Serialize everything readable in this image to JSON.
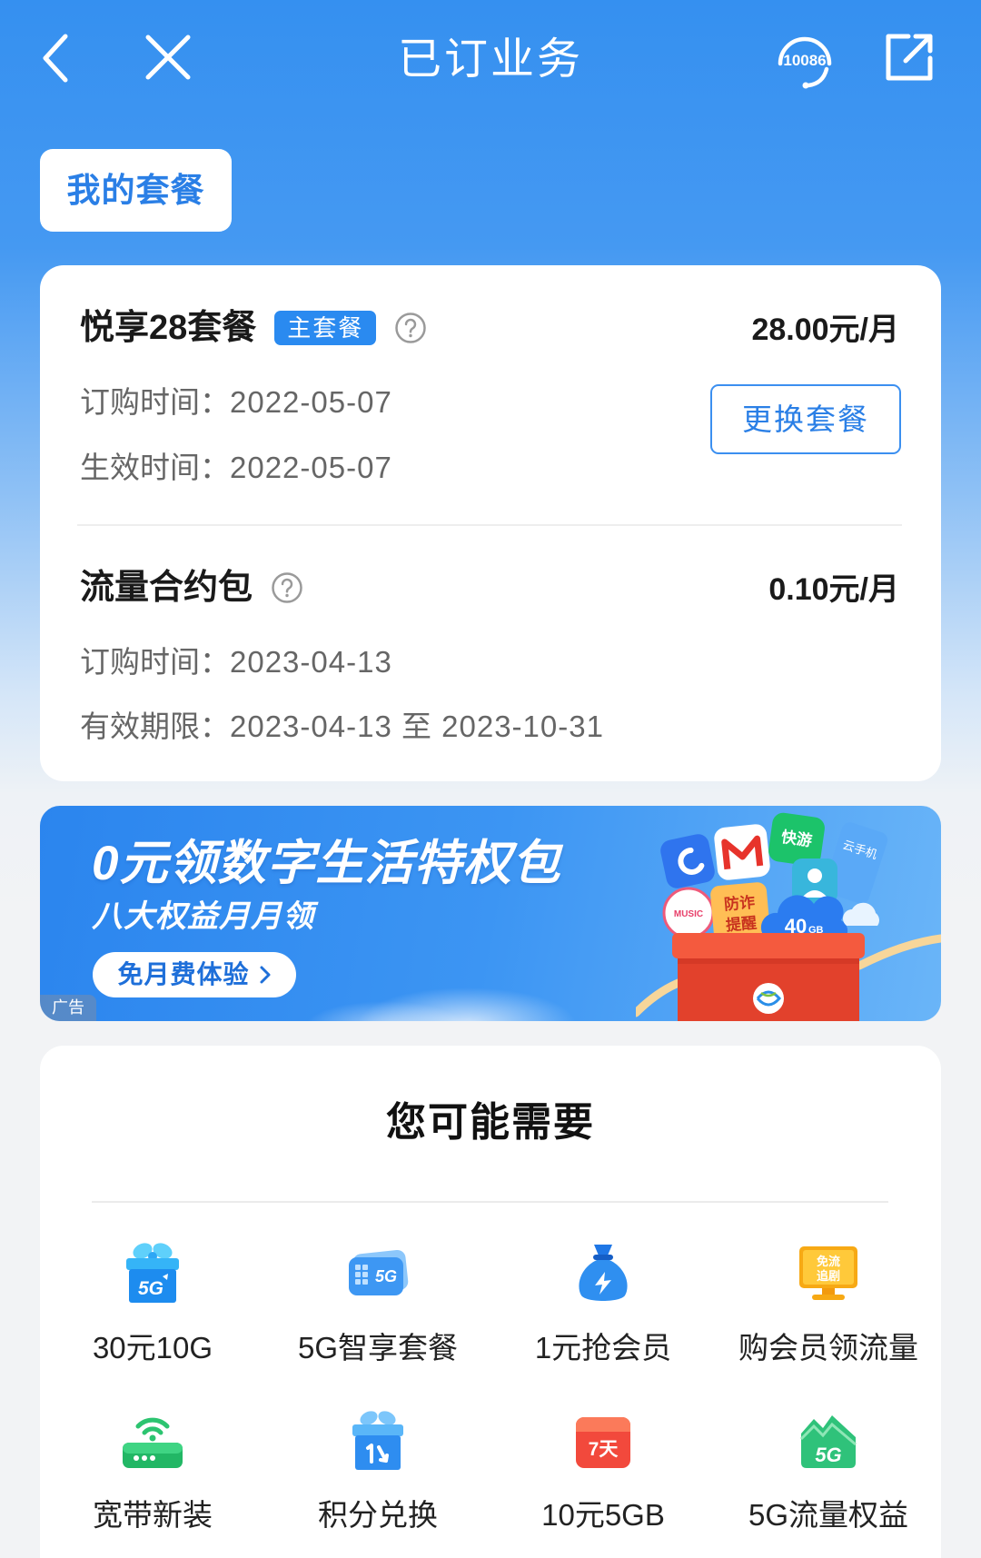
{
  "header": {
    "title": "已订业务",
    "hotline": "10086",
    "back_icon": "chevron-left-icon",
    "close_icon": "close-icon",
    "service_icon": "headset-icon",
    "share_icon": "share-icon"
  },
  "tab": {
    "label": "我的套餐"
  },
  "packages": [
    {
      "name": "悦享28套餐",
      "badge": "主套餐",
      "price": "28.00元/月",
      "rows": [
        {
          "label": "订购时间：",
          "value": "2022-05-07"
        },
        {
          "label": "生效时间：",
          "value": "2022-05-07"
        }
      ],
      "action": "更换套餐"
    },
    {
      "name": "流量合约包",
      "price": "0.10元/月",
      "rows": [
        {
          "label": "订购时间：",
          "value": "2023-04-13"
        },
        {
          "label": "有效期限：",
          "value": "2023-04-13 至 2023-10-31"
        }
      ]
    }
  ],
  "banner": {
    "headline": "0元领数字生活特权包",
    "subline": "八大权益月月领",
    "cta": "免月费体验",
    "ad_label": "广告",
    "illustration": {
      "tile_game": "快游",
      "tile_cloud_phone": "云手机",
      "tile_music": "MUSIC",
      "tile_fraud_1": "防诈",
      "tile_fraud_2": "提醒",
      "tile_data_amount": "40",
      "tile_data_unit": "GB"
    }
  },
  "recommend": {
    "title": "您可能需要",
    "items": [
      {
        "label": "30元10G",
        "icon": "gift-5g-icon",
        "icon_text": "5G"
      },
      {
        "label": "5G智享套餐",
        "icon": "sim-card-5g-icon",
        "icon_text": "5G"
      },
      {
        "label": "1元抢会员",
        "icon": "money-bag-icon"
      },
      {
        "label": "购会员领流量",
        "icon": "tv-monitor-icon",
        "icon_text_1": "免流",
        "icon_text_2": "追剧"
      },
      {
        "label": "宽带新装",
        "icon": "router-icon"
      },
      {
        "label": "积分兑换",
        "icon": "points-gift-icon"
      },
      {
        "label": "10元5GB",
        "icon": "calendar-7day-icon",
        "icon_text": "7天"
      },
      {
        "label": "5G流量权益",
        "icon": "5g-badge-icon",
        "icon_text": "5G"
      }
    ]
  },
  "colors": {
    "header_blue": "#3590f0",
    "accent": "#2a7fe6",
    "badge": "#2a8af0",
    "page_bg": "#f2f3f5",
    "text_primary": "#1a1a1a",
    "text_secondary": "#666666"
  }
}
